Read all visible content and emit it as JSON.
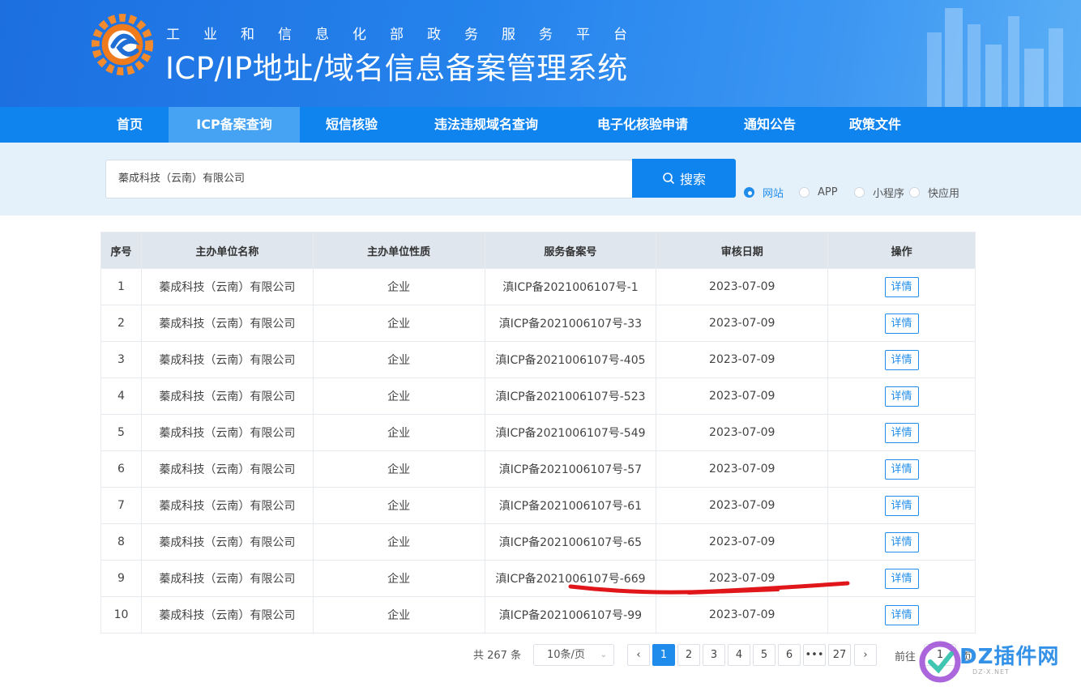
{
  "header": {
    "sub_title": "工业和信息化部政务服务平台",
    "main_title": "ICP/IP地址/域名信息备案管理系统"
  },
  "nav": {
    "items": [
      {
        "label": "首页"
      },
      {
        "label": "ICP备案查询",
        "active": true
      },
      {
        "label": "短信核验"
      },
      {
        "label": "违法违规域名查询"
      },
      {
        "label": "电子化核验申请"
      },
      {
        "label": "通知公告"
      },
      {
        "label": "政策文件"
      }
    ]
  },
  "search": {
    "value": "蓁成科技（云南）有限公司",
    "button_label": "搜索",
    "button_icon": "search-icon",
    "types": [
      {
        "label": "网站",
        "checked": true
      },
      {
        "label": "APP",
        "checked": false
      },
      {
        "label": "小程序",
        "checked": false
      },
      {
        "label": "快应用",
        "checked": false
      }
    ]
  },
  "table": {
    "headers": [
      "序号",
      "主办单位名称",
      "主办单位性质",
      "服务备案号",
      "审核日期",
      "操作"
    ],
    "rows": [
      {
        "idx": "1",
        "name": "蓁成科技（云南）有限公司",
        "type": "企业",
        "icp": "滇ICP备2021006107号-1",
        "date": "2023-07-09",
        "action": "详情"
      },
      {
        "idx": "2",
        "name": "蓁成科技（云南）有限公司",
        "type": "企业",
        "icp": "滇ICP备2021006107号-33",
        "date": "2023-07-09",
        "action": "详情"
      },
      {
        "idx": "3",
        "name": "蓁成科技（云南）有限公司",
        "type": "企业",
        "icp": "滇ICP备2021006107号-405",
        "date": "2023-07-09",
        "action": "详情"
      },
      {
        "idx": "4",
        "name": "蓁成科技（云南）有限公司",
        "type": "企业",
        "icp": "滇ICP备2021006107号-523",
        "date": "2023-07-09",
        "action": "详情"
      },
      {
        "idx": "5",
        "name": "蓁成科技（云南）有限公司",
        "type": "企业",
        "icp": "滇ICP备2021006107号-549",
        "date": "2023-07-09",
        "action": "详情"
      },
      {
        "idx": "6",
        "name": "蓁成科技（云南）有限公司",
        "type": "企业",
        "icp": "滇ICP备2021006107号-57",
        "date": "2023-07-09",
        "action": "详情"
      },
      {
        "idx": "7",
        "name": "蓁成科技（云南）有限公司",
        "type": "企业",
        "icp": "滇ICP备2021006107号-61",
        "date": "2023-07-09",
        "action": "详情"
      },
      {
        "idx": "8",
        "name": "蓁成科技（云南）有限公司",
        "type": "企业",
        "icp": "滇ICP备2021006107号-65",
        "date": "2023-07-09",
        "action": "详情"
      },
      {
        "idx": "9",
        "name": "蓁成科技（云南）有限公司",
        "type": "企业",
        "icp": "滇ICP备2021006107号-669",
        "date": "2023-07-09",
        "action": "详情"
      },
      {
        "idx": "10",
        "name": "蓁成科技（云南）有限公司",
        "type": "企业",
        "icp": "滇ICP备2021006107号-99",
        "date": "2023-07-09",
        "action": "详情"
      }
    ]
  },
  "pagination": {
    "total_text": "共 267 条",
    "page_size": "10条/页",
    "prev_icon": "chevron-left-icon",
    "next_icon": "chevron-right-icon",
    "pages": [
      "1",
      "2",
      "3",
      "4",
      "5",
      "6",
      "•••",
      "27"
    ],
    "current": "1",
    "goto_prefix": "前往",
    "goto_value": "1",
    "goto_suffix": "页"
  },
  "watermark": {
    "text": "DZ插件网",
    "sub": "DZ-X.NET"
  },
  "colors": {
    "primary": "#0f83ee",
    "nav_active": "#46a3f3",
    "search_band": "#e4f1fb",
    "table_header": "#dfe6ee",
    "annotation_red": "#e0161b"
  }
}
